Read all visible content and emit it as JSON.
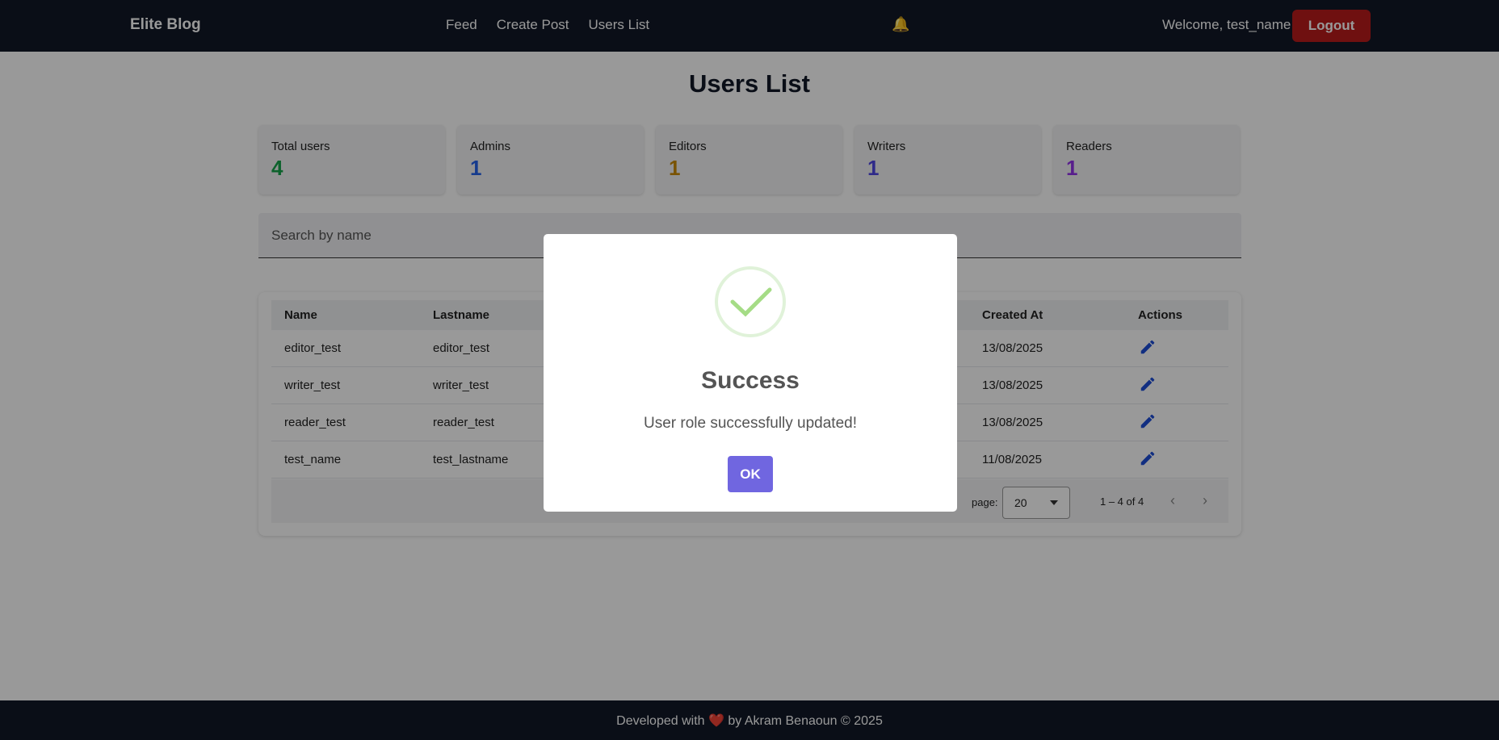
{
  "navbar": {
    "brand": "Elite Blog",
    "links": [
      "Feed",
      "Create Post",
      "Users List"
    ],
    "bell_icon": "bell-icon",
    "welcome": "Welcome, test_name",
    "logout": "Logout"
  },
  "page": {
    "title": "Users List",
    "stats": [
      {
        "label": "Total users",
        "value": "4",
        "color": "#16a34a"
      },
      {
        "label": "Admins",
        "value": "1",
        "color": "#2563eb"
      },
      {
        "label": "Editors",
        "value": "1",
        "color": "#ca8a04"
      },
      {
        "label": "Writers",
        "value": "1",
        "color": "#4f46e5"
      },
      {
        "label": "Readers",
        "value": "1",
        "color": "#9333ea"
      }
    ],
    "search_placeholder": "Search by name"
  },
  "table": {
    "headers": {
      "name": "Name",
      "lastname": "Lastname",
      "created_at": "Created At",
      "actions": "Actions"
    },
    "rows": [
      {
        "name": "editor_test",
        "lastname": "editor_test",
        "created_at": "13/08/2025"
      },
      {
        "name": "writer_test",
        "lastname": "writer_test",
        "created_at": "13/08/2025"
      },
      {
        "name": "reader_test",
        "lastname": "reader_test",
        "created_at": "13/08/2025"
      },
      {
        "name": "test_name",
        "lastname": "test_lastname",
        "created_at": "11/08/2025"
      }
    ],
    "rows_per_page_label": "page:",
    "rows_per_page_value": "20",
    "range": "1 – 4 of 4",
    "edit_icon": "pencil-icon",
    "edit_icon_color": "#1d4ed8"
  },
  "footer": {
    "text_before": "Developed with",
    "heart": "❤️",
    "text_after": "by Akram Benaoun © 2025"
  },
  "modal": {
    "icon": "success-check-icon",
    "title": "Success",
    "message": "User role successfully updated!",
    "ok": "OK",
    "ok_color": "#7066e0"
  }
}
